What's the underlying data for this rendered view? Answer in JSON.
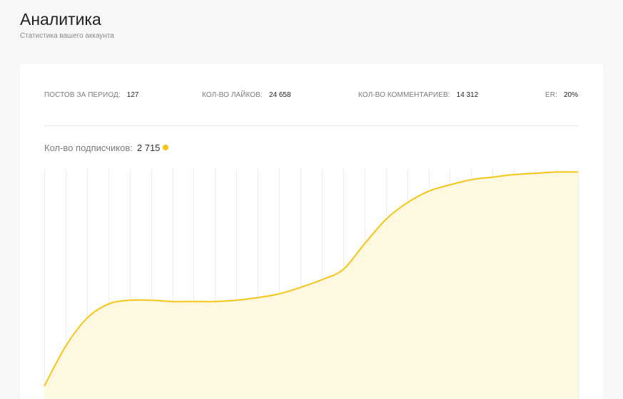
{
  "header": {
    "title": "Аналитика",
    "subtitle": "Статистика вашего аккаунта"
  },
  "stats": [
    {
      "label": "ПОСТОВ ЗА ПЕРИОД:",
      "value": "127"
    },
    {
      "label": "КОЛ-ВО ЛАЙКОВ:",
      "value": "24 658"
    },
    {
      "label": "КОЛ-ВО КОММЕНТАРИЕВ:",
      "value": "14 312"
    },
    {
      "label": "ER:",
      "value": "20%"
    }
  ],
  "subscribers": {
    "label": "Кол-во подписчиков:",
    "value": "2 715"
  },
  "colors": {
    "accent": "#f5c518",
    "area_fill": "#fff8e1",
    "grid": "#ececec"
  },
  "chart_data": {
    "type": "area",
    "title": "",
    "xlabel": "",
    "ylabel": "",
    "grid": true,
    "x": [
      0,
      1,
      2,
      3,
      4,
      5,
      6,
      7,
      8,
      9,
      10,
      11,
      12,
      13,
      14,
      15,
      16,
      17,
      18,
      19,
      20,
      21,
      22,
      23,
      24,
      25
    ],
    "series": [
      {
        "name": "",
        "values": [
          0,
          31,
          53,
          64,
          67,
          67,
          66,
          66,
          66,
          67,
          69,
          72,
          77,
          83,
          91,
          111,
          130,
          143,
          152,
          157,
          161,
          163,
          165,
          166,
          167,
          167
        ]
      }
    ],
    "xlim": [
      0,
      25
    ],
    "ylim": [
      0,
      170
    ]
  }
}
